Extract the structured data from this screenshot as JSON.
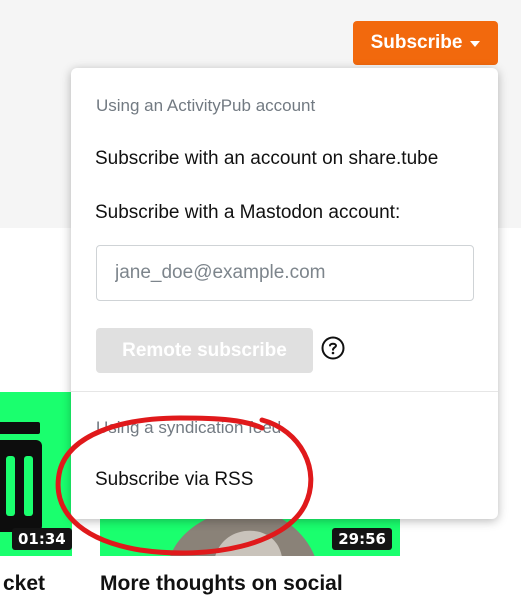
{
  "header": {
    "subscribe_label": "Subscribe"
  },
  "dropdown": {
    "activitypub_header": "Using an ActivityPub account",
    "subscribe_account_label": "Subscribe with an account on share.tube",
    "mastodon_label": "Subscribe with a Mastodon account:",
    "email_placeholder": "jane_doe@example.com",
    "remote_subscribe_label": "Remote subscribe",
    "syndication_header": "Using a syndication feed",
    "rss_label": "Subscribe via RSS"
  },
  "videos": [
    {
      "title": "cket",
      "duration": "01:34"
    },
    {
      "title": "More thoughts on social",
      "duration": "29:56"
    }
  ],
  "colors": {
    "accent": "#f2690d",
    "thumbnail_green": "#1aff6e",
    "annotation_red": "#e0191b"
  }
}
